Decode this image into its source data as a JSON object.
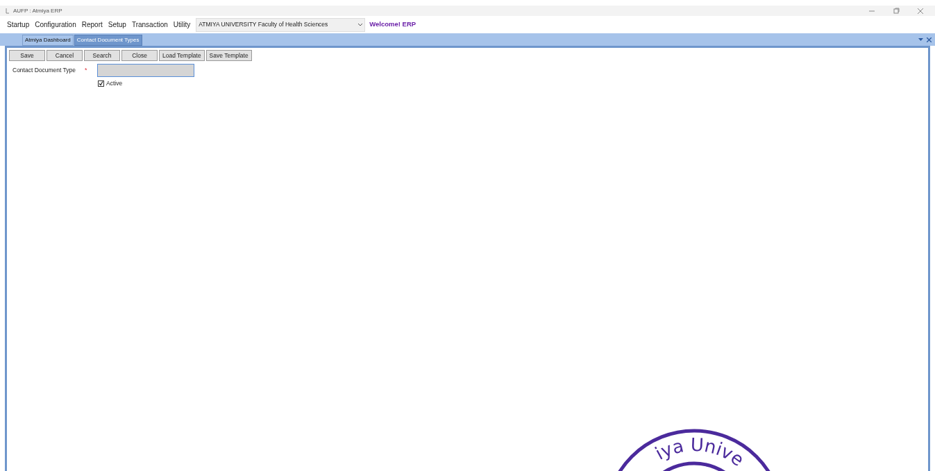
{
  "window": {
    "title": "AUFP : Atmiya ERP"
  },
  "menu": [
    {
      "label": "Startup"
    },
    {
      "label": "Configuration"
    },
    {
      "label": "Report"
    },
    {
      "label": "Setup"
    },
    {
      "label": "Transaction"
    },
    {
      "label": "Utility"
    }
  ],
  "institute_select": {
    "value": "ATMIYA UNIVERSITY Faculty of Health Sciences"
  },
  "welcome": "Welcome! ERP",
  "tabs": [
    {
      "label": "Atmiya Dashboard",
      "selected": false
    },
    {
      "label": "Contact Document Types",
      "selected": true
    }
  ],
  "toolbar": [
    "Save",
    "Cancel",
    "Search",
    "Close",
    "Load Template",
    "Save Template"
  ],
  "form": {
    "field_label": "Contact Document Type",
    "required_mark": "*",
    "active": {
      "label": "Active",
      "checked": true
    }
  },
  "seal": {
    "text": "iya Unive"
  }
}
